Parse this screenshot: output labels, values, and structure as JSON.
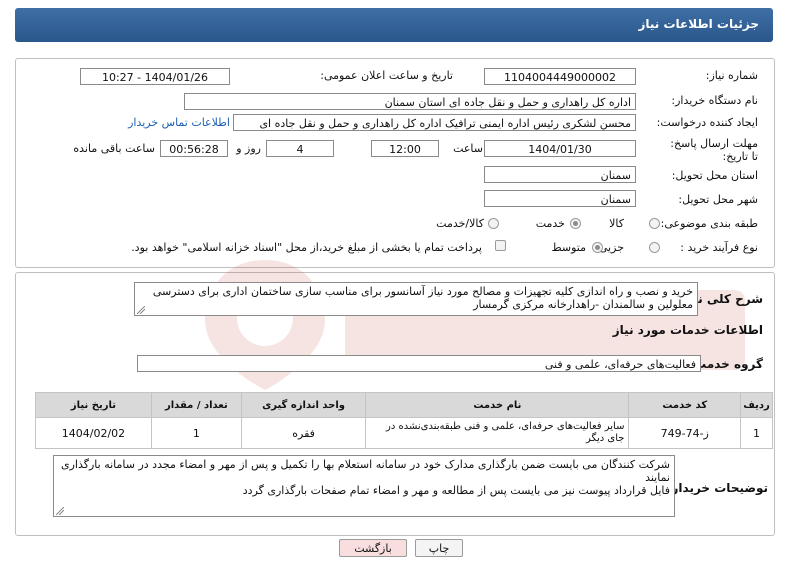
{
  "header": {
    "title": "جزئیات اطلاعات نیاز"
  },
  "form": {
    "need_number_label": "شماره نیاز:",
    "need_number": "1104004449000002",
    "announce_label": "تاریخ و ساعت اعلان عمومی:",
    "announce_value": "1404/01/26 - 10:27",
    "buyer_org_label": "نام دستگاه خریدار:",
    "buyer_org": "اداره کل راهداری و حمل و نقل جاده ای استان سمنان",
    "requester_label": "ایجاد کننده درخواست:",
    "requester": "محسن لشکری رئیس اداره ایمنی ترافیک اداره کل راهداری و حمل و نقل جاده ای",
    "contact_link": "اطلاعات تماس خریدار",
    "deadline_label": "مهلت ارسال پاسخ: تا تاریخ:",
    "deadline_date": "1404/01/30",
    "time_label": "ساعت",
    "deadline_time": "12:00",
    "days_value": "4",
    "days_label": "روز و",
    "remaining_time": "00:56:28",
    "remaining_label": "ساعت باقی مانده",
    "province_label": "استان محل تحویل:",
    "province": "سمنان",
    "city_label": "شهر محل تحویل:",
    "city": "سمنان",
    "category_label": "طبقه بندی موضوعی:",
    "category_options": [
      "کالا",
      "خدمت",
      "کالا/خدمت"
    ],
    "category_selected": "خدمت",
    "process_label": "نوع فرآیند خرید :",
    "process_options": [
      "جزیی",
      "متوسط"
    ],
    "process_selected": "متوسط",
    "payment_note": "پرداخت تمام یا بخشی از مبلغ خرید،از محل \"اسناد خزانه اسلامی\" خواهد بود."
  },
  "description": {
    "label": "شرح کلی نیاز:",
    "text": "خرید و نصب و راه اندازی کلیه تجهیزات و مصالح مورد نیاز آسانسور برای مناسب سازی ساختمان اداری برای دسترسی معلولین و سالمندان -راهدارخانه مرکزی گرمسار"
  },
  "services": {
    "title": "اطلاعات خدمات مورد نیاز",
    "group_label": "گروه خدمت:",
    "group_value": "فعالیت‌های حرفه‌ای، علمی و فنی",
    "columns": [
      "ردیف",
      "کد خدمت",
      "نام خدمت",
      "واحد اندازه گیری",
      "تعداد / مقدار",
      "تاریخ نیاز"
    ],
    "rows": [
      {
        "index": "1",
        "code": "ز-74-749",
        "name": "سایر فعالیت‌های حرفه‌ای، علمی و فنی طبقه‌بندی‌نشده در جای دیگر",
        "unit": "فقره",
        "qty": "1",
        "date": "1404/02/02"
      }
    ]
  },
  "buyer_notes": {
    "label": "توضیحات خریدار:",
    "line1": "شرکت کنندگان می بایست ضمن بارگذاری مدارک خود در سامانه استعلام بها را تکمیل و پس از مهر و امضاء مجدد در سامانه بارگذاری نمایند",
    "line2": "فایل قرارداد پیوست نیز می بایست پس از مطالعه و مهر و امضاء تمام صفحات بارگذاری گردد"
  },
  "buttons": {
    "print": "چاپ",
    "back": "بازگشت"
  },
  "colors": {
    "header": "#2f5f96",
    "link": "#1c5fb5",
    "back_button": "#f8dede"
  }
}
